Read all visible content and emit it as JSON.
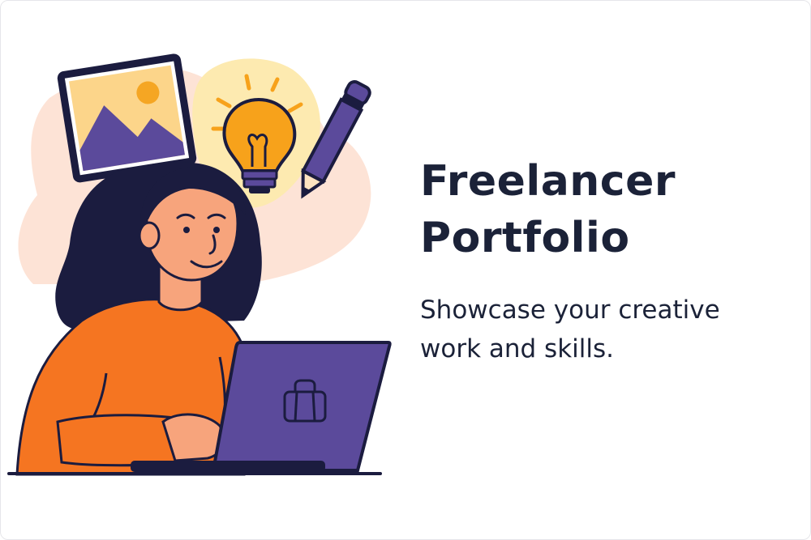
{
  "hero": {
    "title_line1": "Freelancer",
    "title_line2": "Portfolio",
    "subtitle_line1": "Showcase your creative",
    "subtitle_line2": "work and skills."
  },
  "illustration": {
    "icons": [
      "image-icon",
      "lightbulb-icon",
      "pencil-icon",
      "briefcase-icon"
    ],
    "colors": {
      "orange": "#f57521",
      "purple": "#5b4a9b",
      "navy": "#1b1c3f",
      "skin": "#f7a47c",
      "blob_pink": "#fde3d6",
      "blob_yellow": "#fdeab0",
      "bulb": "#f7a21b",
      "sun": "#f5a623"
    }
  }
}
